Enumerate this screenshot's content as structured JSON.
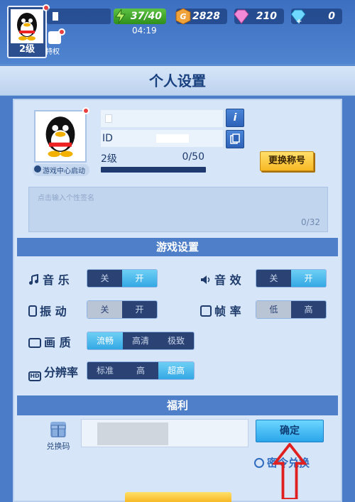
{
  "topbar": {
    "level": "2级",
    "privilege_label": "特权",
    "energy": "37/40",
    "timer": "04:19",
    "coins": "2828",
    "pink_gems": "210",
    "diamonds": "0"
  },
  "panel": {
    "title": "个人设置",
    "game_center_label": "游戏中心启动",
    "id_prefix": "ID",
    "level": "2级",
    "xp": "0/50",
    "change_title_button": "更换称号",
    "signature_placeholder": "点击输入个性签名",
    "signature_count": "0/32"
  },
  "game_settings": {
    "header": "游戏设置",
    "music": {
      "label": "音 乐",
      "options": [
        "关",
        "开"
      ]
    },
    "sound": {
      "label": "音 效",
      "options": [
        "关",
        "开"
      ]
    },
    "vibration": {
      "label": "振 动",
      "options": [
        "关",
        "开"
      ]
    },
    "framerate": {
      "label": "帧 率",
      "options": [
        "低",
        "高"
      ]
    },
    "quality": {
      "label": "画 质",
      "options": [
        "流畅",
        "高清",
        "极致"
      ]
    },
    "resolution": {
      "label": "分辨率",
      "options": [
        "标准",
        "高",
        "超高"
      ]
    }
  },
  "welfare": {
    "header": "福利",
    "redeem_label": "兑换码",
    "confirm_button": "确定",
    "secret_redeem": "密令兑换"
  },
  "colors": {
    "accent": "#33a8e4",
    "title_button": "#f7b824",
    "arrow": "#e02020"
  }
}
